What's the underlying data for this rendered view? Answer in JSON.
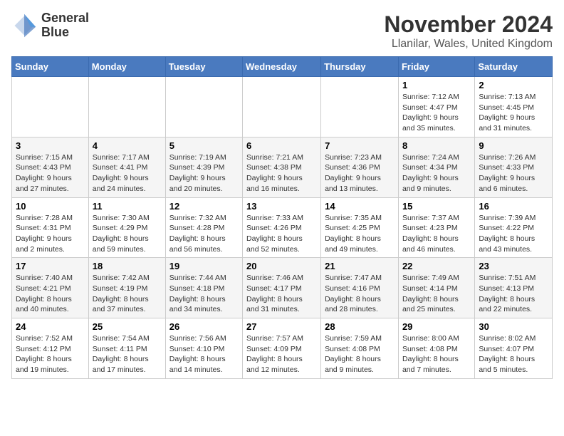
{
  "header": {
    "logo_line1": "General",
    "logo_line2": "Blue",
    "month_title": "November 2024",
    "location": "Llanilar, Wales, United Kingdom"
  },
  "weekdays": [
    "Sunday",
    "Monday",
    "Tuesday",
    "Wednesday",
    "Thursday",
    "Friday",
    "Saturday"
  ],
  "weeks": [
    [
      {
        "day": "",
        "info": ""
      },
      {
        "day": "",
        "info": ""
      },
      {
        "day": "",
        "info": ""
      },
      {
        "day": "",
        "info": ""
      },
      {
        "day": "",
        "info": ""
      },
      {
        "day": "1",
        "info": "Sunrise: 7:12 AM\nSunset: 4:47 PM\nDaylight: 9 hours\nand 35 minutes."
      },
      {
        "day": "2",
        "info": "Sunrise: 7:13 AM\nSunset: 4:45 PM\nDaylight: 9 hours\nand 31 minutes."
      }
    ],
    [
      {
        "day": "3",
        "info": "Sunrise: 7:15 AM\nSunset: 4:43 PM\nDaylight: 9 hours\nand 27 minutes."
      },
      {
        "day": "4",
        "info": "Sunrise: 7:17 AM\nSunset: 4:41 PM\nDaylight: 9 hours\nand 24 minutes."
      },
      {
        "day": "5",
        "info": "Sunrise: 7:19 AM\nSunset: 4:39 PM\nDaylight: 9 hours\nand 20 minutes."
      },
      {
        "day": "6",
        "info": "Sunrise: 7:21 AM\nSunset: 4:38 PM\nDaylight: 9 hours\nand 16 minutes."
      },
      {
        "day": "7",
        "info": "Sunrise: 7:23 AM\nSunset: 4:36 PM\nDaylight: 9 hours\nand 13 minutes."
      },
      {
        "day": "8",
        "info": "Sunrise: 7:24 AM\nSunset: 4:34 PM\nDaylight: 9 hours\nand 9 minutes."
      },
      {
        "day": "9",
        "info": "Sunrise: 7:26 AM\nSunset: 4:33 PM\nDaylight: 9 hours\nand 6 minutes."
      }
    ],
    [
      {
        "day": "10",
        "info": "Sunrise: 7:28 AM\nSunset: 4:31 PM\nDaylight: 9 hours\nand 2 minutes."
      },
      {
        "day": "11",
        "info": "Sunrise: 7:30 AM\nSunset: 4:29 PM\nDaylight: 8 hours\nand 59 minutes."
      },
      {
        "day": "12",
        "info": "Sunrise: 7:32 AM\nSunset: 4:28 PM\nDaylight: 8 hours\nand 56 minutes."
      },
      {
        "day": "13",
        "info": "Sunrise: 7:33 AM\nSunset: 4:26 PM\nDaylight: 8 hours\nand 52 minutes."
      },
      {
        "day": "14",
        "info": "Sunrise: 7:35 AM\nSunset: 4:25 PM\nDaylight: 8 hours\nand 49 minutes."
      },
      {
        "day": "15",
        "info": "Sunrise: 7:37 AM\nSunset: 4:23 PM\nDaylight: 8 hours\nand 46 minutes."
      },
      {
        "day": "16",
        "info": "Sunrise: 7:39 AM\nSunset: 4:22 PM\nDaylight: 8 hours\nand 43 minutes."
      }
    ],
    [
      {
        "day": "17",
        "info": "Sunrise: 7:40 AM\nSunset: 4:21 PM\nDaylight: 8 hours\nand 40 minutes."
      },
      {
        "day": "18",
        "info": "Sunrise: 7:42 AM\nSunset: 4:19 PM\nDaylight: 8 hours\nand 37 minutes."
      },
      {
        "day": "19",
        "info": "Sunrise: 7:44 AM\nSunset: 4:18 PM\nDaylight: 8 hours\nand 34 minutes."
      },
      {
        "day": "20",
        "info": "Sunrise: 7:46 AM\nSunset: 4:17 PM\nDaylight: 8 hours\nand 31 minutes."
      },
      {
        "day": "21",
        "info": "Sunrise: 7:47 AM\nSunset: 4:16 PM\nDaylight: 8 hours\nand 28 minutes."
      },
      {
        "day": "22",
        "info": "Sunrise: 7:49 AM\nSunset: 4:14 PM\nDaylight: 8 hours\nand 25 minutes."
      },
      {
        "day": "23",
        "info": "Sunrise: 7:51 AM\nSunset: 4:13 PM\nDaylight: 8 hours\nand 22 minutes."
      }
    ],
    [
      {
        "day": "24",
        "info": "Sunrise: 7:52 AM\nSunset: 4:12 PM\nDaylight: 8 hours\nand 19 minutes."
      },
      {
        "day": "25",
        "info": "Sunrise: 7:54 AM\nSunset: 4:11 PM\nDaylight: 8 hours\nand 17 minutes."
      },
      {
        "day": "26",
        "info": "Sunrise: 7:56 AM\nSunset: 4:10 PM\nDaylight: 8 hours\nand 14 minutes."
      },
      {
        "day": "27",
        "info": "Sunrise: 7:57 AM\nSunset: 4:09 PM\nDaylight: 8 hours\nand 12 minutes."
      },
      {
        "day": "28",
        "info": "Sunrise: 7:59 AM\nSunset: 4:08 PM\nDaylight: 8 hours\nand 9 minutes."
      },
      {
        "day": "29",
        "info": "Sunrise: 8:00 AM\nSunset: 4:08 PM\nDaylight: 8 hours\nand 7 minutes."
      },
      {
        "day": "30",
        "info": "Sunrise: 8:02 AM\nSunset: 4:07 PM\nDaylight: 8 hours\nand 5 minutes."
      }
    ]
  ]
}
